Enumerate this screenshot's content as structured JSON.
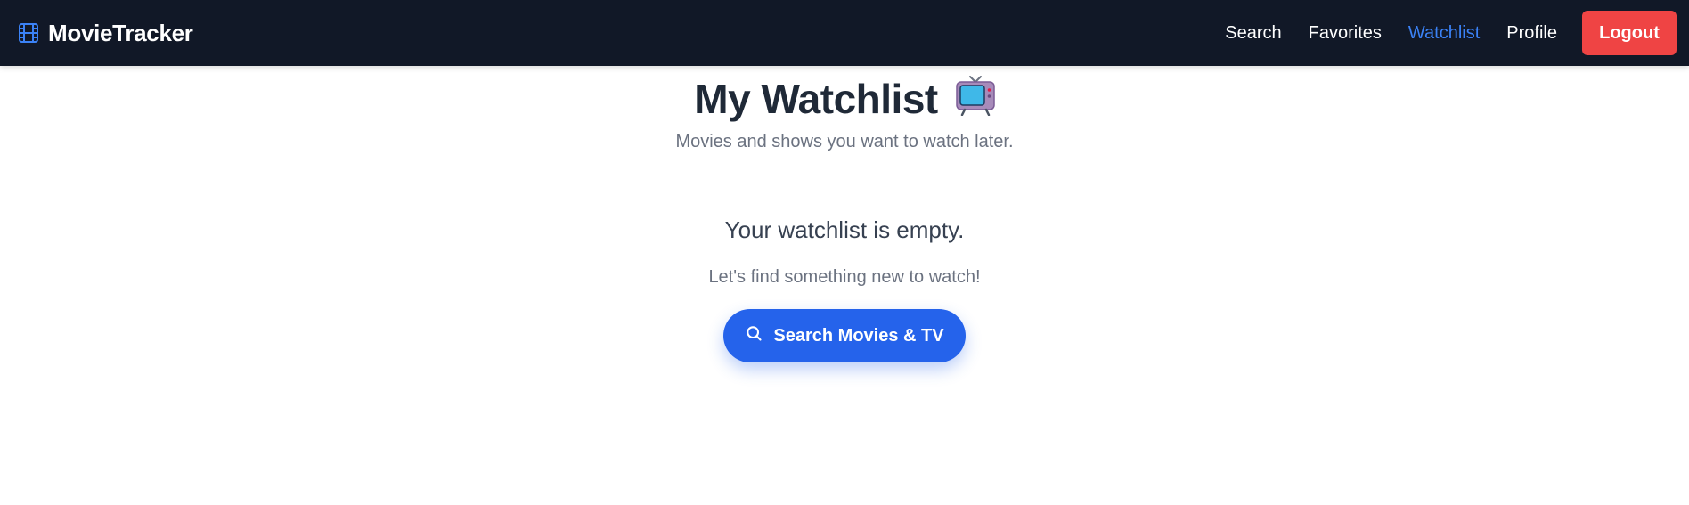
{
  "navbar": {
    "brand_icon": "film-icon",
    "brand_name": "MovieTracker",
    "links": [
      {
        "label": "Search",
        "active": false
      },
      {
        "label": "Favorites",
        "active": false
      },
      {
        "label": "Watchlist",
        "active": true
      },
      {
        "label": "Profile",
        "active": false
      }
    ],
    "logout_label": "Logout"
  },
  "header": {
    "title": "My Watchlist",
    "title_icon": "television-icon",
    "subtitle": "Movies and shows you want to watch later."
  },
  "empty_state": {
    "title": "Your watchlist is empty.",
    "text": "Let's find something new to watch!",
    "button_label": "Search Movies & TV",
    "button_icon": "search-icon"
  },
  "colors": {
    "navbar_bg": "#111827",
    "accent": "#3b82f6",
    "button_primary": "#2563eb",
    "logout": "#ef4444"
  }
}
